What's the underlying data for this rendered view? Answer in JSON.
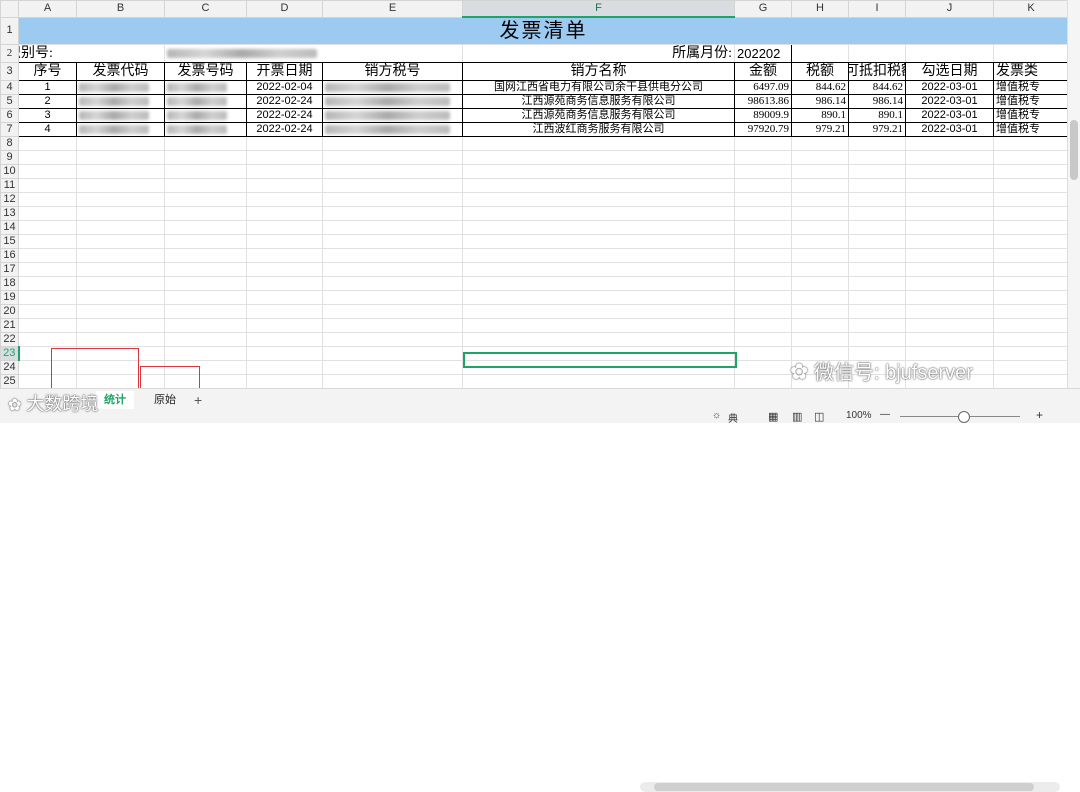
{
  "columns": [
    "A",
    "B",
    "C",
    "D",
    "E",
    "F",
    "G",
    "H",
    "I",
    "J",
    "K"
  ],
  "selected_column": "F",
  "selected_row": "23",
  "rows": [
    "1",
    "2",
    "3",
    "4",
    "5",
    "6",
    "7",
    "8",
    "9",
    "10",
    "11",
    "12",
    "13",
    "14",
    "15",
    "16",
    "17",
    "18",
    "19",
    "20",
    "21",
    "22",
    "23",
    "24",
    "25"
  ],
  "sheet": {
    "title": "发票清单",
    "id_label": "识别号:",
    "month_label": "所属月份:",
    "month_value": "202202",
    "headers": [
      "序号",
      "发票代码",
      "发票号码",
      "开票日期",
      "销方税号",
      "销方名称",
      "金额",
      "税额",
      "可抵扣税额",
      "勾选日期",
      "发票类"
    ],
    "records": [
      {
        "seq": "1",
        "date": "2022-02-04",
        "seller": "国网江西省电力有限公司余干县供电分公司",
        "amount": "6497.09",
        "tax": "844.62",
        "deductible": "844.62",
        "check_date": "2022-03-01",
        "type": "增值税专"
      },
      {
        "seq": "2",
        "date": "2022-02-24",
        "seller": "江西源苑商务信息服务有限公司",
        "amount": "98613.86",
        "tax": "986.14",
        "deductible": "986.14",
        "check_date": "2022-03-01",
        "type": "增值税专"
      },
      {
        "seq": "3",
        "date": "2022-02-24",
        "seller": "江西源苑商务信息服务有限公司",
        "amount": "89009.9",
        "tax": "890.1",
        "deductible": "890.1",
        "check_date": "2022-03-01",
        "type": "增值税专"
      },
      {
        "seq": "4",
        "date": "2022-02-24",
        "seller": "江西波红商务服务有限公司",
        "amount": "97920.79",
        "tax": "979.21",
        "deductible": "979.21",
        "check_date": "2022-03-01",
        "type": "增值税专"
      }
    ]
  },
  "tabs": [
    {
      "label": "统计"
    },
    {
      "label": "原始"
    }
  ],
  "add_tab_label": "+",
  "status": {
    "zoom": "100%",
    "zoom_minus": "—",
    "zoom_plus": "+",
    "view_mode": "典"
  },
  "watermark_right": "微信号: bjufserver",
  "watermark_left": "大数跨境",
  "colors": {
    "title_fill": "#9ccaf0",
    "accent": "#21a366",
    "red_annotation": "#d9363e"
  }
}
